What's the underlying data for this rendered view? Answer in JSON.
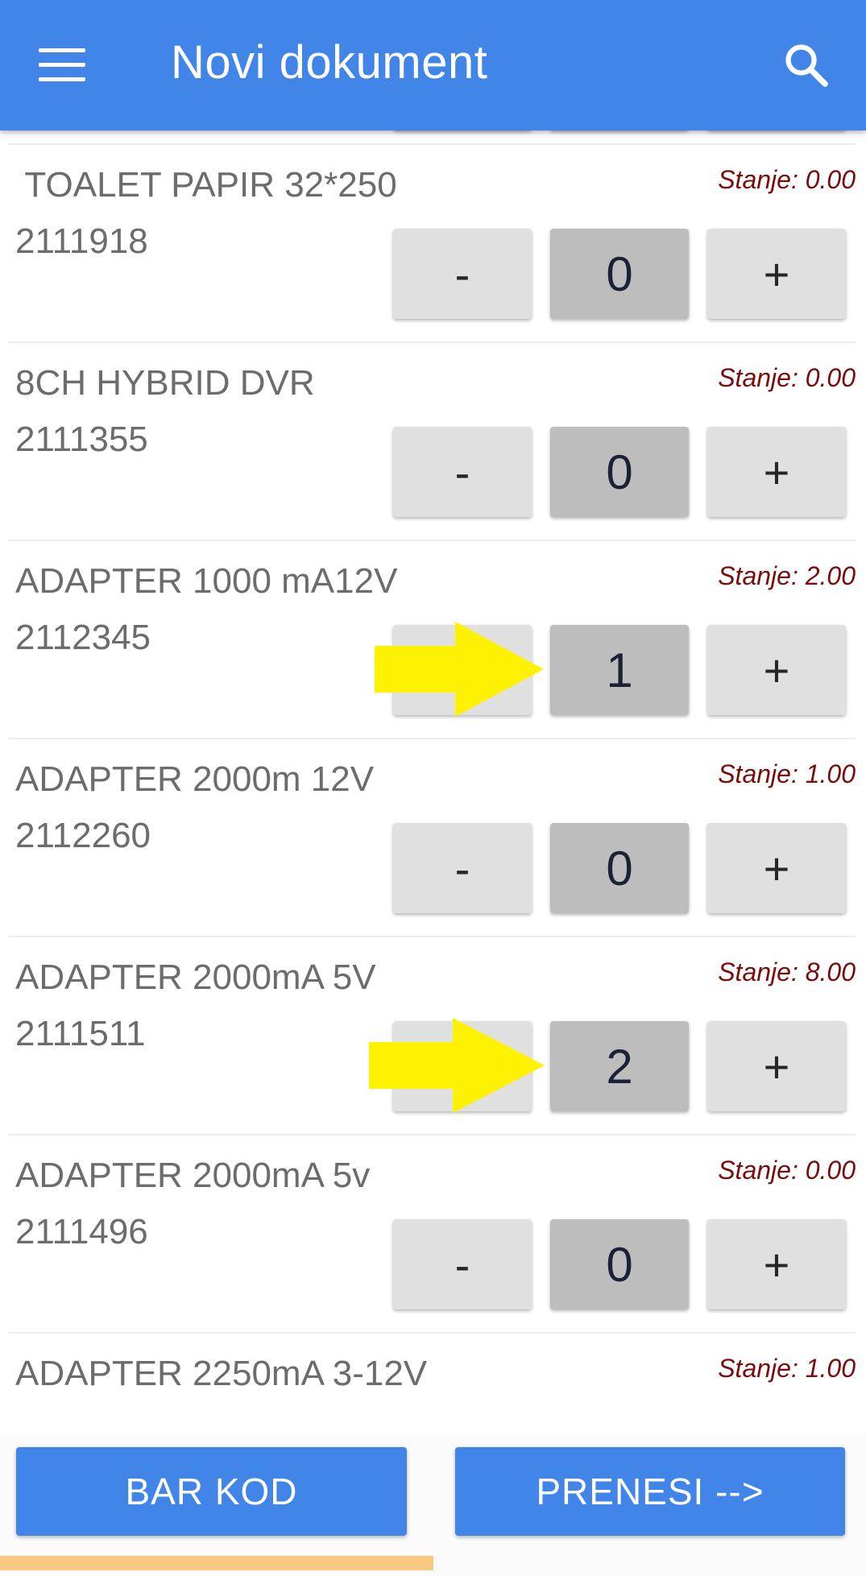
{
  "app_bar": {
    "title": "Novi dokument",
    "menu_icon": "hamburger-menu-icon",
    "search_icon": "search-icon",
    "color": "#4285e8"
  },
  "items": [
    {
      "name": " TOALET PAPIR 32*250",
      "code": "2111918",
      "stock": "Stanje: 0.00",
      "minus": "-",
      "qty": "0",
      "plus": "+"
    },
    {
      "name": "8CH HYBRID DVR",
      "code": "2111355",
      "stock": "Stanje: 0.00",
      "minus": "-",
      "qty": "0",
      "plus": "+"
    },
    {
      "name": "ADAPTER 1000 mA12V",
      "code": "2112345",
      "stock": "Stanje: 2.00",
      "minus": "-",
      "qty": "1",
      "plus": "+"
    },
    {
      "name": "ADAPTER 2000m 12V",
      "code": "2112260",
      "stock": "Stanje: 1.00",
      "minus": "-",
      "qty": "0",
      "plus": "+"
    },
    {
      "name": "ADAPTER 2000mA 5V",
      "code": "2111511",
      "stock": "Stanje: 8.00",
      "minus": "-",
      "qty": "2",
      "plus": "+"
    },
    {
      "name": "ADAPTER 2000mA 5v",
      "code": "2111496",
      "stock": "Stanje: 0.00",
      "minus": "-",
      "qty": "0",
      "plus": "+"
    },
    {
      "name": "ADAPTER 2250mA 3-12V",
      "code": "",
      "stock": "Stanje: 1.00"
    }
  ],
  "annotations": {
    "arrow_color": "#fff200"
  },
  "footer": {
    "barcode_label": "BAR KOD",
    "transfer_label": "PRENESI -->",
    "progress_fraction": 0.5,
    "progress_color": "#f9c983"
  }
}
